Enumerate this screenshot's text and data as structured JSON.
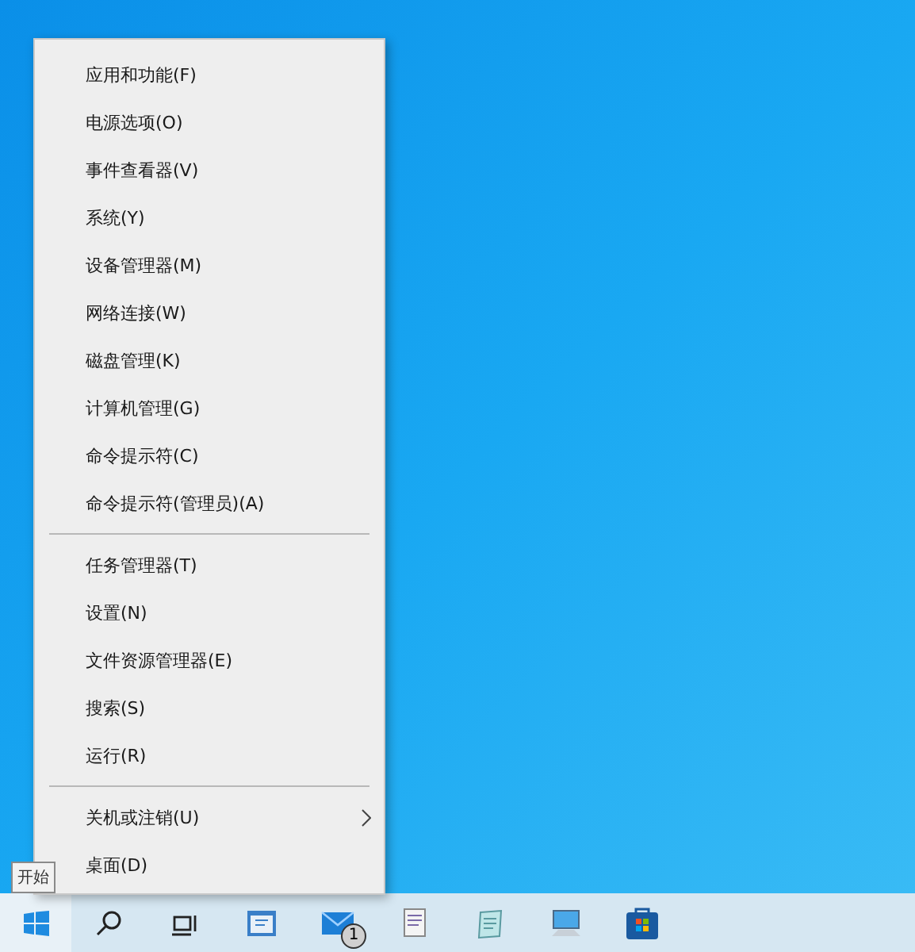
{
  "context_menu": {
    "groups": [
      {
        "items": [
          {
            "label": "应用和功能(F)",
            "has_submenu": false
          },
          {
            "label": "电源选项(O)",
            "has_submenu": false
          },
          {
            "label": "事件查看器(V)",
            "has_submenu": false
          },
          {
            "label": "系统(Y)",
            "has_submenu": false
          },
          {
            "label": "设备管理器(M)",
            "has_submenu": false
          },
          {
            "label": "网络连接(W)",
            "has_submenu": false
          },
          {
            "label": "磁盘管理(K)",
            "has_submenu": false
          },
          {
            "label": "计算机管理(G)",
            "has_submenu": false
          },
          {
            "label": "命令提示符(C)",
            "has_submenu": false
          },
          {
            "label": "命令提示符(管理员)(A)",
            "has_submenu": false
          }
        ]
      },
      {
        "items": [
          {
            "label": "任务管理器(T)",
            "has_submenu": false
          },
          {
            "label": "设置(N)",
            "has_submenu": false
          },
          {
            "label": "文件资源管理器(E)",
            "has_submenu": false
          },
          {
            "label": "搜索(S)",
            "has_submenu": false
          },
          {
            "label": "运行(R)",
            "has_submenu": false
          }
        ]
      },
      {
        "items": [
          {
            "label": "关机或注销(U)",
            "has_submenu": true
          },
          {
            "label": "桌面(D)",
            "has_submenu": false
          }
        ]
      }
    ]
  },
  "start_tooltip": "开始",
  "taskbar": {
    "items": [
      {
        "kind": "start"
      },
      {
        "kind": "search"
      },
      {
        "kind": "task-view"
      },
      {
        "kind": "app"
      },
      {
        "kind": "mail",
        "badge": "1"
      },
      {
        "kind": "document"
      },
      {
        "kind": "notepad"
      },
      {
        "kind": "computer"
      },
      {
        "kind": "store"
      }
    ]
  }
}
